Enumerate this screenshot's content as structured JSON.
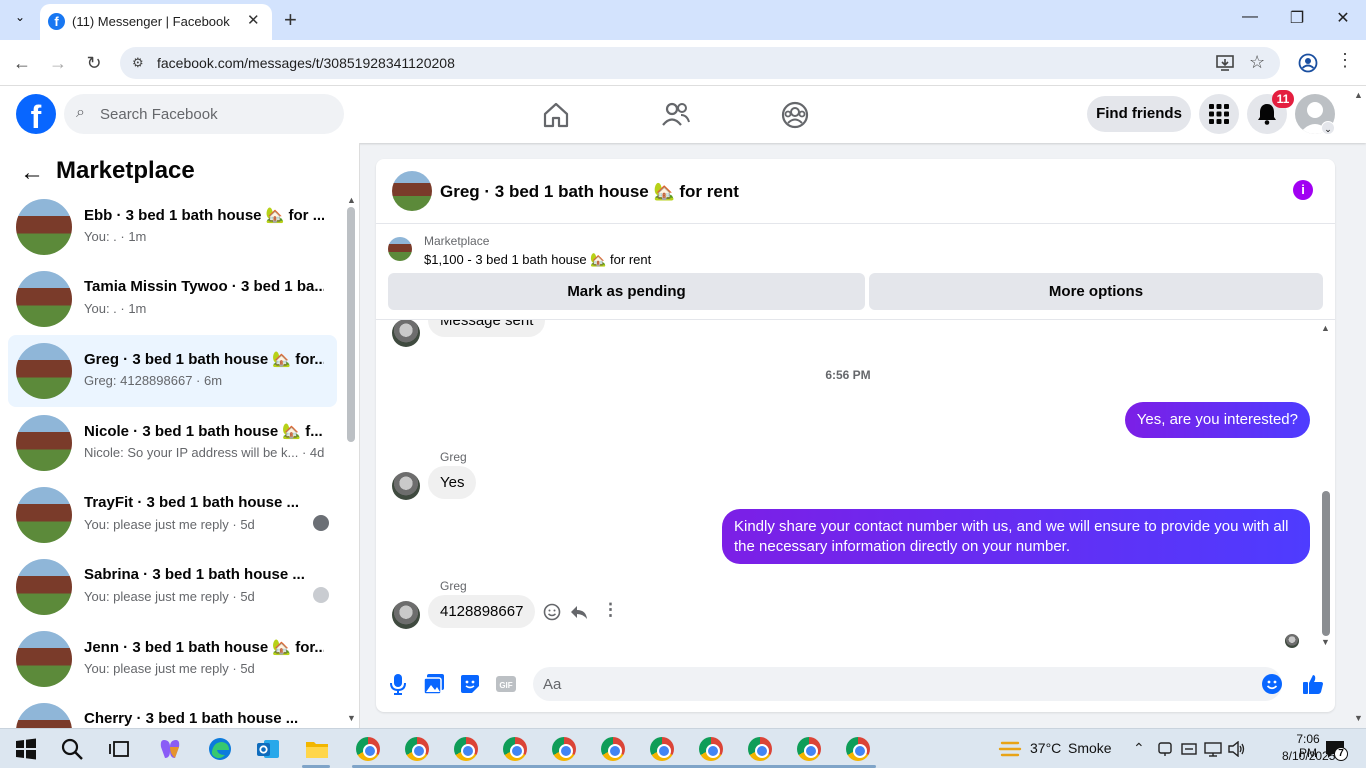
{
  "browser": {
    "tab_title": "(11) Messenger | Facebook",
    "url": "facebook.com/messages/t/30851928341120208"
  },
  "fb": {
    "search_placeholder": "Search Facebook",
    "find_friends": "Find friends",
    "notification_count": "11"
  },
  "sidebar": {
    "title": "Marketplace",
    "conversations": [
      {
        "name": "Ebb · 3 bed 1 bath house 🏡 for ...",
        "preview": "You: . · 1m",
        "active": false
      },
      {
        "name": "Tamia Missin Tywoo · 3 bed 1 ba...",
        "preview": "You: . · 1m",
        "active": false
      },
      {
        "name": "Greg · 3 bed 1 bath house 🏡 for...",
        "preview": "Greg: 4128898667 · 6m",
        "active": true
      },
      {
        "name": "Nicole · 3 bed 1 bath house 🏡 f...",
        "preview": "Nicole: So your IP address will be k... · 4d",
        "active": false
      },
      {
        "name": "TrayFit · 3 bed 1 bath house ...",
        "preview": "You: please just me reply · 5d",
        "active": false
      },
      {
        "name": "Sabrina · 3 bed 1 bath house ...",
        "preview": "You: please just me reply · 5d",
        "active": false
      },
      {
        "name": "Jenn · 3 bed 1 bath house 🏡 for...",
        "preview": "You: please just me reply · 5d",
        "active": false
      },
      {
        "name": "Cherry · 3 bed 1 bath house ...",
        "preview": "",
        "active": false
      }
    ]
  },
  "chat": {
    "title": "Greg · 3 bed 1 bath house 🏡 for rent",
    "listing_label": "Marketplace",
    "listing_desc": "$1,100 - 3 bed 1 bath house 🏡 for rent",
    "mark_pending": "Mark as pending",
    "more_options": "More options",
    "messages": {
      "sent_status": "Message sent",
      "timestamp": "6:56 PM",
      "out1": "Yes, are you interested?",
      "sender1": "Greg",
      "in1": "Yes",
      "out2": "Kindly share your contact number with us, and we will ensure to provide you with all the necessary information directly on your number.",
      "sender2": "Greg",
      "in2": "4128898667"
    },
    "input_placeholder": "Aa"
  },
  "taskbar": {
    "temperature": "37°C",
    "weather": "Smoke",
    "time": "7:06 PM",
    "date": "8/10/2025",
    "notification_count": "7"
  },
  "colors": {
    "fb_blue": "#0866ff",
    "outgoing_bubble": "#7c1fe6",
    "active_conversation": "#ebf5ff"
  }
}
